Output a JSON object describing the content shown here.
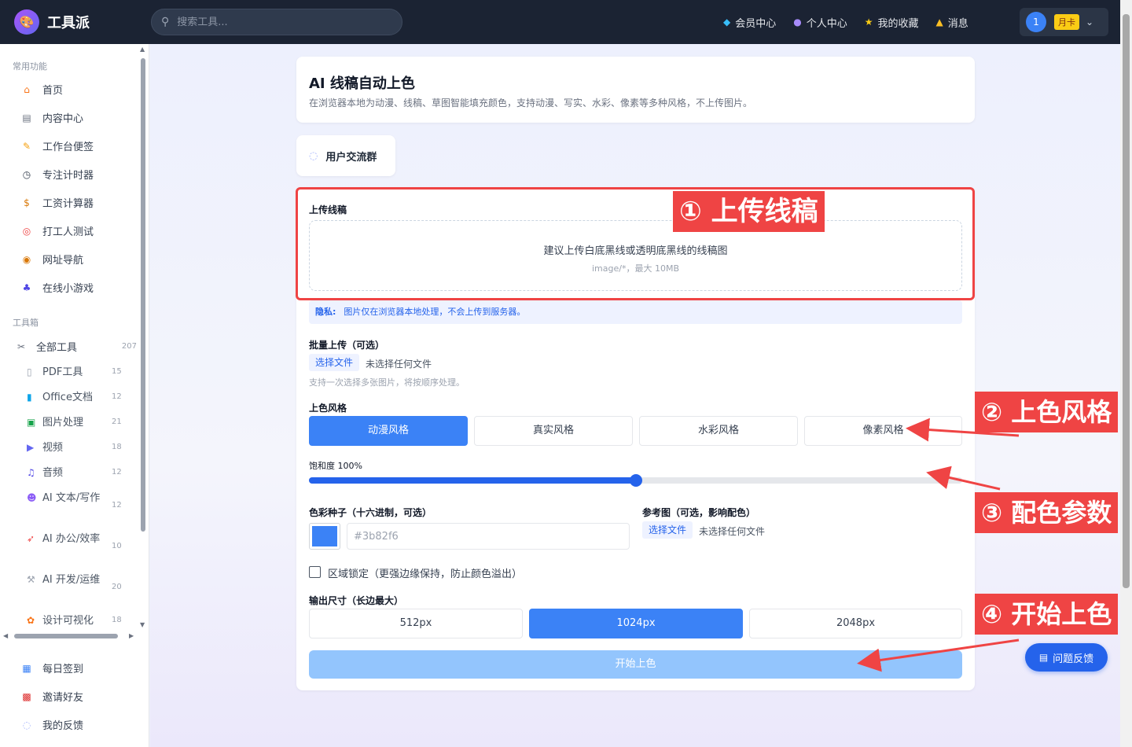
{
  "app": {
    "name": "工具派",
    "logo_icon": "palette-icon"
  },
  "search": {
    "placeholder": "搜索工具..."
  },
  "topnav": [
    {
      "label": "会员中心",
      "icon": "diamond-icon"
    },
    {
      "label": "个人中心",
      "icon": "user-icon"
    },
    {
      "label": "我的收藏",
      "icon": "star-icon"
    },
    {
      "label": "消息",
      "icon": "bell-icon"
    }
  ],
  "user": {
    "avatar": "1",
    "badge": "月卡"
  },
  "sidebar": {
    "common_title": "常用功能",
    "common": [
      {
        "label": "首页",
        "icon": "home-icon"
      },
      {
        "label": "内容中心",
        "icon": "newspaper-icon"
      },
      {
        "label": "工作台便签",
        "icon": "memo-icon"
      },
      {
        "label": "专注计时器",
        "icon": "timer-icon"
      },
      {
        "label": "工资计算器",
        "icon": "money-bag-icon"
      },
      {
        "label": "打工人测试",
        "icon": "target-icon"
      },
      {
        "label": "网址导航",
        "icon": "compass-icon"
      },
      {
        "label": "在线小游戏",
        "icon": "gamepad-icon"
      }
    ],
    "toolbox_title": "工具箱",
    "all_tools": {
      "label": "全部工具",
      "count": "207"
    },
    "tools": [
      {
        "label": "PDF工具",
        "count": "15"
      },
      {
        "label": "Office文档",
        "count": "12"
      },
      {
        "label": "图片处理",
        "count": "21"
      },
      {
        "label": "视频",
        "count": "18"
      },
      {
        "label": "音频",
        "count": "12"
      },
      {
        "label": "AI 文本/写作",
        "count": "12"
      },
      {
        "label": "AI 办公/效率",
        "count": "10"
      },
      {
        "label": "AI 开发/运维",
        "count": "20"
      },
      {
        "label": "设计可视化",
        "count": "18"
      }
    ],
    "bottom": [
      {
        "label": "每日签到",
        "icon": "calendar-icon"
      },
      {
        "label": "邀请好友",
        "icon": "gift-icon"
      },
      {
        "label": "我的反馈",
        "icon": "speech-bubble-icon"
      }
    ]
  },
  "page": {
    "title": "AI 线稿自动上色",
    "description": "在浏览器本地为动漫、线稿、草图智能填充颜色，支持动漫、写实、水彩、像素等多种风格，不上传图片。",
    "group_button": "用户交流群"
  },
  "form": {
    "upload_label": "上传线稿",
    "upload_hint": "建议上传白底黑线或透明底黑线的线稿图",
    "upload_sub": "image/*，最大 10MB",
    "privacy_label": "隐私:",
    "privacy_text": "图片仅在浏览器本地处理，不会上传到服务器。",
    "batch_label": "批量上传（可选）",
    "choose_file": "选择文件",
    "no_file": "未选择任何文件",
    "batch_hint": "支持一次选择多张图片，将按顺序处理。",
    "style_label": "上色风格",
    "styles": [
      "动漫风格",
      "真实风格",
      "水彩风格",
      "像素风格"
    ],
    "active_style": 0,
    "saturation_label": "饱和度 100%",
    "saturation_value": 0.5,
    "seed_label": "色彩种子（十六进制，可选）",
    "seed_color": "#3b82f6",
    "seed_placeholder": "#3b82f6",
    "ref_label": "参考图（可选，影响配色）",
    "ref_choose": "选择文件",
    "ref_none": "未选择任何文件",
    "lock_label": "区域锁定（更强边缘保持，防止颜色溢出）",
    "size_label": "输出尺寸（长边最大）",
    "sizes": [
      "512px",
      "1024px",
      "2048px"
    ],
    "active_size": 1,
    "start_button": "开始上色"
  },
  "annotations": {
    "a1": "① 上传线稿",
    "a2": "② 上色风格",
    "a3": "③ 配色参数",
    "a4": "④ 开始上色",
    "color": "#ef4444"
  },
  "feedback": {
    "label": "问题反馈"
  }
}
